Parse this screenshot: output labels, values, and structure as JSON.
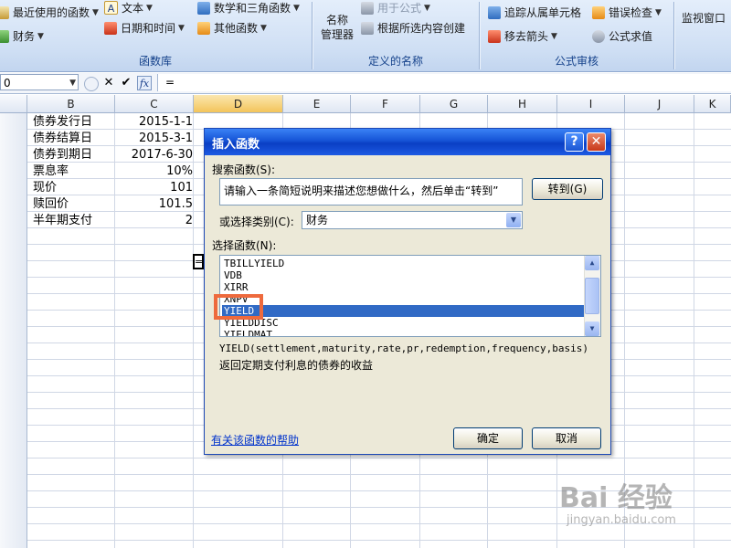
{
  "ribbon": {
    "groups": [
      {
        "label": "函数库"
      },
      {
        "label": "定义的名称"
      },
      {
        "label": "公式审核"
      }
    ],
    "recent_functions": "最近使用的函数",
    "financial": "财务",
    "text": "文本",
    "date_time": "日期和时间",
    "math_trig": "数学和三角函数",
    "other_functions": "其他函数",
    "name_manager_line1": "名称",
    "name_manager_line2": "管理器",
    "use_in_formula": "用于公式",
    "create_from_selection": "根据所选内容创建",
    "trace_dependents": "追踪从属单元格",
    "error_checking": "错误检查",
    "remove_arrows": "移去箭头",
    "evaluate_formula": "公式求值",
    "watch_window": "监视窗口"
  },
  "formula_bar": {
    "name_box": "0",
    "content": "="
  },
  "sheet": {
    "columns": [
      "B",
      "C",
      "D",
      "E",
      "F",
      "G",
      "H",
      "I",
      "J",
      "K"
    ],
    "active_column": "D",
    "rows": [
      {
        "label": "债券发行日",
        "value": "2015-1-1"
      },
      {
        "label": "债券结算日",
        "value": "2015-3-1"
      },
      {
        "label": "债券到期日",
        "value": "2017-6-30"
      },
      {
        "label": "票息率",
        "value": "10%"
      },
      {
        "label": "现价",
        "value": "101"
      },
      {
        "label": "赎回价",
        "value": "101.5"
      },
      {
        "label": "半年期支付",
        "value": "2"
      }
    ],
    "active_cell_content": "="
  },
  "dialog": {
    "title": "插入函数",
    "help_button": "?",
    "close_button": "✕",
    "search_label": "搜索函数(S):",
    "search_text": "请输入一条简短说明来描述您想做什么，然后单击“转到”",
    "goto_button": "转到(G)",
    "category_label": "或选择类别(C):",
    "category_value": "财务",
    "select_label": "选择函数(N):",
    "functions": [
      "TBILLYIELD",
      "VDB",
      "XIRR",
      "XNPV",
      "YIELD",
      "YIELDDISC",
      "YIELDMAT"
    ],
    "selected_function": "YIELD",
    "syntax": "YIELD(settlement,maturity,rate,pr,redemption,frequency,basis)",
    "description": "返回定期支付利息的债券的收益",
    "help_link": "有关该函数的帮助",
    "ok_button": "确定",
    "cancel_button": "取消"
  },
  "watermark": {
    "logo": "Bai 经验",
    "url": "jingyan.baidu.com"
  },
  "colors": {
    "title_bar": "#1553d6",
    "selection": "#316ac5",
    "highlight_box": "#ee6a3d",
    "ribbon_label": "#15428b"
  }
}
